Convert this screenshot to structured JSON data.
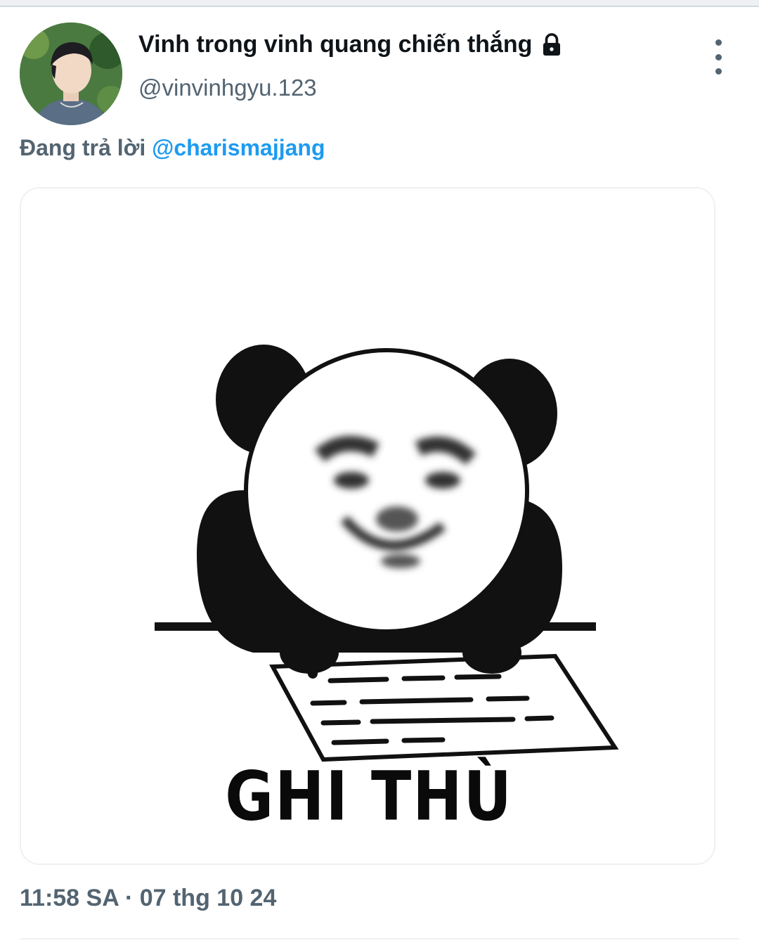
{
  "tweet": {
    "display_name": "Vinh trong vinh quang chiến thắng",
    "handle": "@vinvinhgyu.123",
    "reply_prefix": "Đang trả lời ",
    "reply_mention": "@charismajjang",
    "media_caption": "GHI THÙ",
    "timestamp": "11:58 SA · 07 thg 10 24"
  },
  "icons": {
    "protected": "lock-icon",
    "more": "more-vertical-icon"
  },
  "colors": {
    "link": "#1d9bf0",
    "secondary_text": "#536471",
    "primary_text": "#0f1419"
  }
}
